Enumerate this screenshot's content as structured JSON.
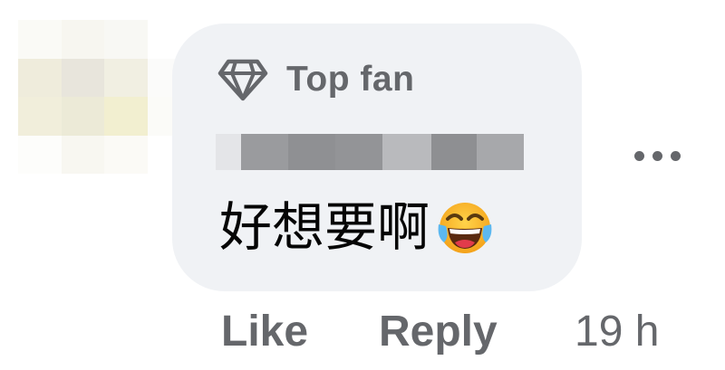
{
  "comment": {
    "badge": {
      "label": "Top fan",
      "icon": "diamond-icon"
    },
    "author": {
      "name_hidden": true
    },
    "text": "好想要啊",
    "emoji": "face-with-tears-of-joy",
    "actions": {
      "like_label": "Like",
      "reply_label": "Reply"
    },
    "timestamp": "19 h",
    "more_icon": "more-options-icon"
  },
  "colors": {
    "bubble_bg": "#f0f2f5",
    "secondary_text": "#65676b",
    "primary_text": "#050505"
  }
}
